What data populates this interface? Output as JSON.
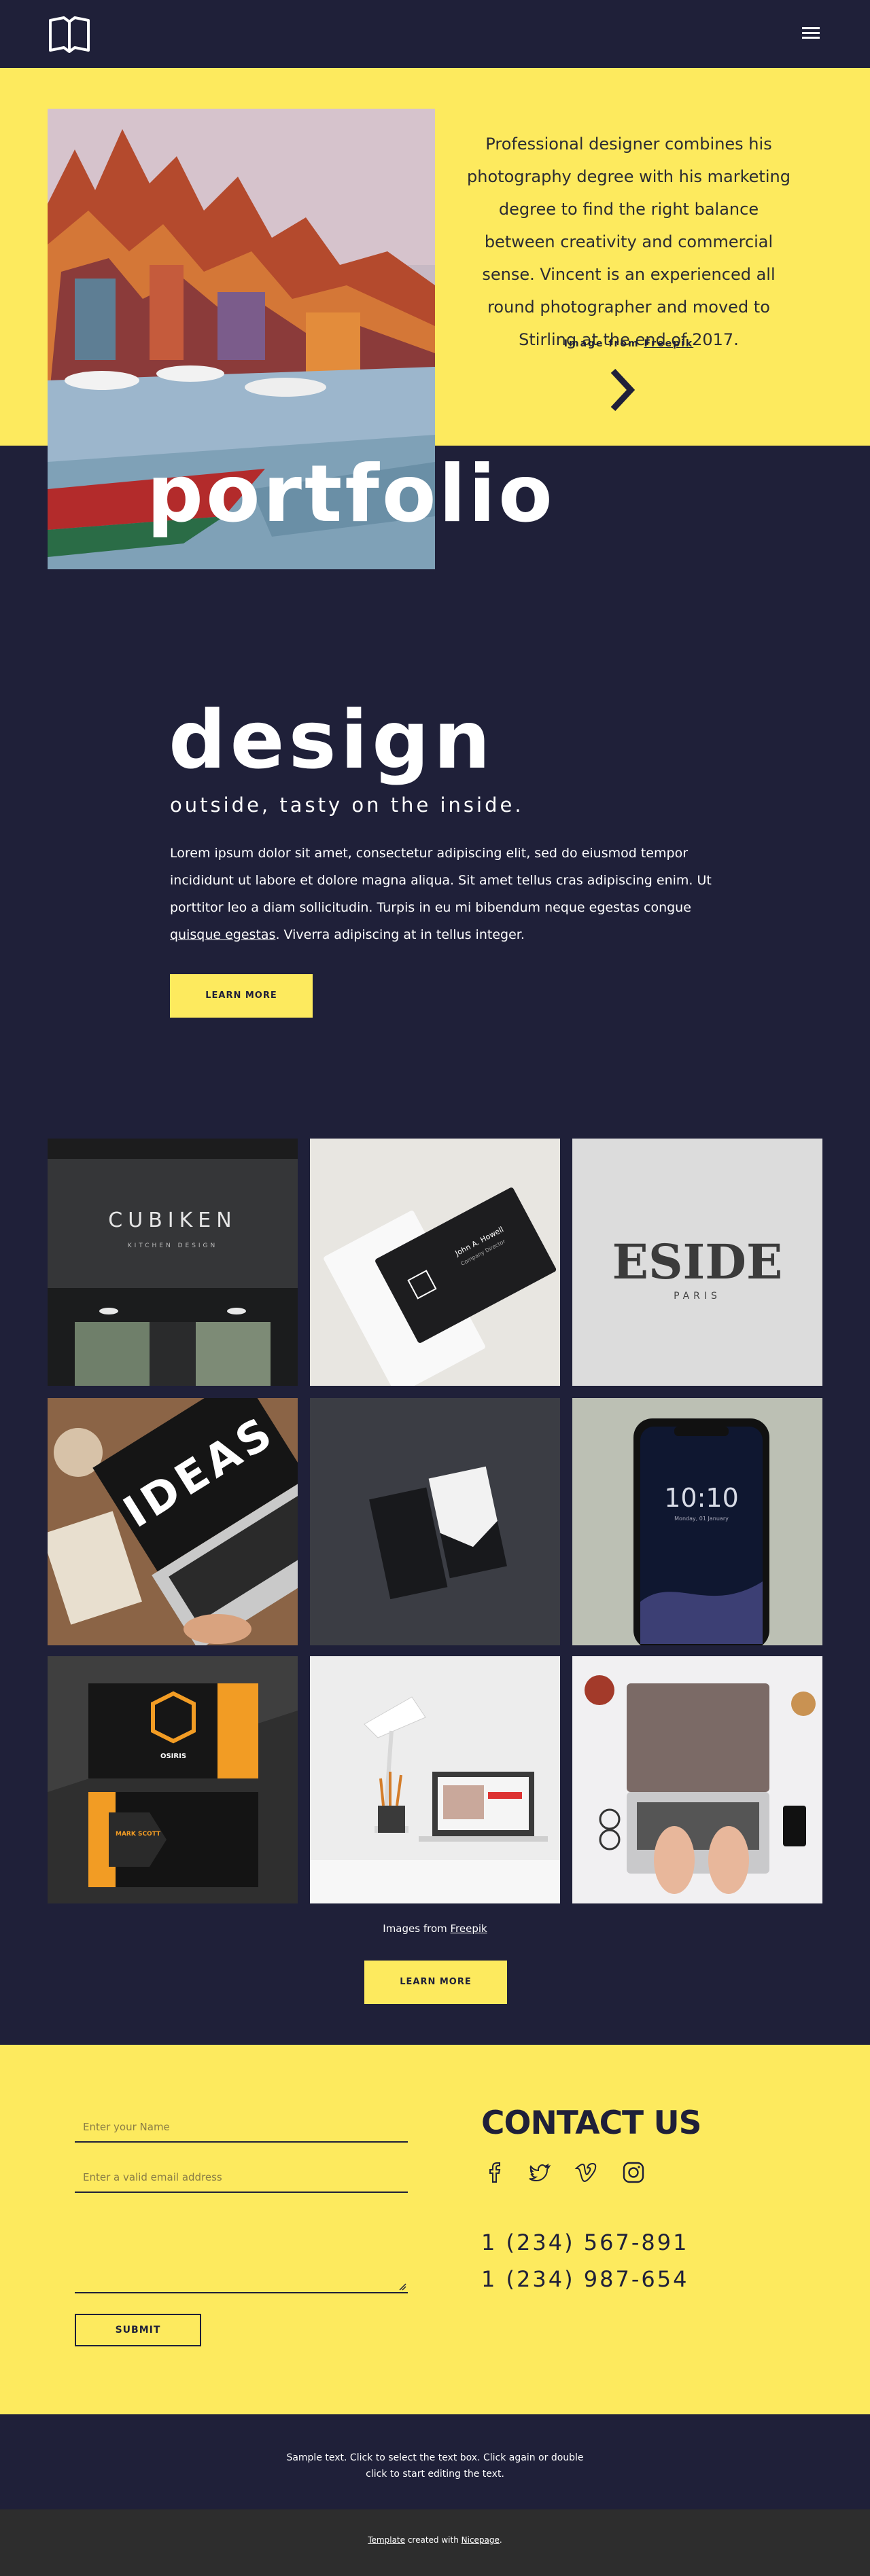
{
  "header": {
    "logo_icon": "book-icon",
    "menu_icon": "hamburger-icon"
  },
  "hero": {
    "description": "Professional designer combines his photography degree with his marketing degree to find the right balance between creativity and commercial sense. Vincent is an experienced all round photographer and moved to Stirling at the end of 2017.",
    "credit_prefix": "Image from",
    "credit_link": "Freepik",
    "next_icon": "chevron-right-icon",
    "heading": "portfolio"
  },
  "design": {
    "title": "design",
    "subtitle": "outside, tasty on the inside.",
    "body_before_link": "Lorem ipsum dolor sit amet, consectetur adipiscing elit, sed do eiusmod tempor incididunt ut labore et dolore magna aliqua. Sit amet tellus cras adipiscing enim. Ut porttitor leo a diam sollicitudin. Turpis in eu mi bibendum neque egestas congue ",
    "body_link": "quisque egestas",
    "body_after_link": ". Viverra adipiscing at in tellus integer.",
    "button": "LEARN MORE"
  },
  "gallery": {
    "tiles": [
      {
        "signage_main": "CUBIKEN",
        "signage_sub": "KITCHEN DESIGN"
      },
      {
        "card_name": "John A. Howell",
        "card_role": "Company Director"
      },
      {
        "emboss_main": "ESIDE",
        "emboss_sub": "PARIS"
      },
      {
        "screen_text": "IDEAS"
      },
      {
        "label": "business cards"
      },
      {
        "phone_time": "10:10",
        "phone_date": "Monday, 01 January"
      },
      {
        "card_front": "OSIRIS",
        "card_back": "MARK SCOTT"
      },
      {
        "label": "desk lamp"
      },
      {
        "label": "typing"
      }
    ],
    "credit_prefix": "Images from",
    "credit_link": "Freepik",
    "button": "LEARN MORE"
  },
  "contact": {
    "name_placeholder": "Enter your Name",
    "email_placeholder": "Enter a valid email address",
    "submit": "SUBMIT",
    "title": "CONTACT US",
    "social_icons": [
      "facebook-icon",
      "twitter-icon",
      "vimeo-icon",
      "instagram-icon"
    ],
    "phones": [
      "1 (234) 567-891",
      "1 (234) 987-654"
    ]
  },
  "footer": {
    "text_line1": "Sample text. Click to select the text box. Click again or double",
    "text_line2": "click to start editing the text.",
    "credit_link1": "Template",
    "credit_middle": " created with ",
    "credit_link2": "Nicepage",
    "credit_end": "."
  },
  "colors": {
    "yellow": "#fdea5e",
    "navy": "#1f2039",
    "footer_gray": "#2d2d2d"
  }
}
